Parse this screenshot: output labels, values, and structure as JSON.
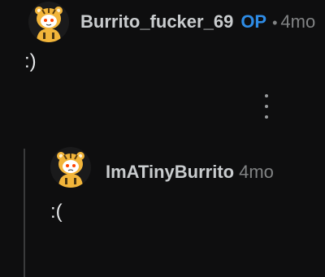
{
  "comments": [
    {
      "username": "Burrito_fucker_69",
      "op_badge": "OP",
      "separator": "•",
      "age": "4mo",
      "body": ":)"
    },
    {
      "username": "ImATinyBurrito",
      "age": "4mo",
      "body": ":("
    }
  ],
  "icons": {
    "avatar": "snoo-tiger-avatar-icon",
    "more": "more-options-vertical-icon"
  },
  "colors": {
    "background": "#0e0e0f",
    "op_badge": "#2e8ce6",
    "meta_gray": "#818384",
    "username": "#c9ccce",
    "thread_line": "#3a3b3c"
  }
}
